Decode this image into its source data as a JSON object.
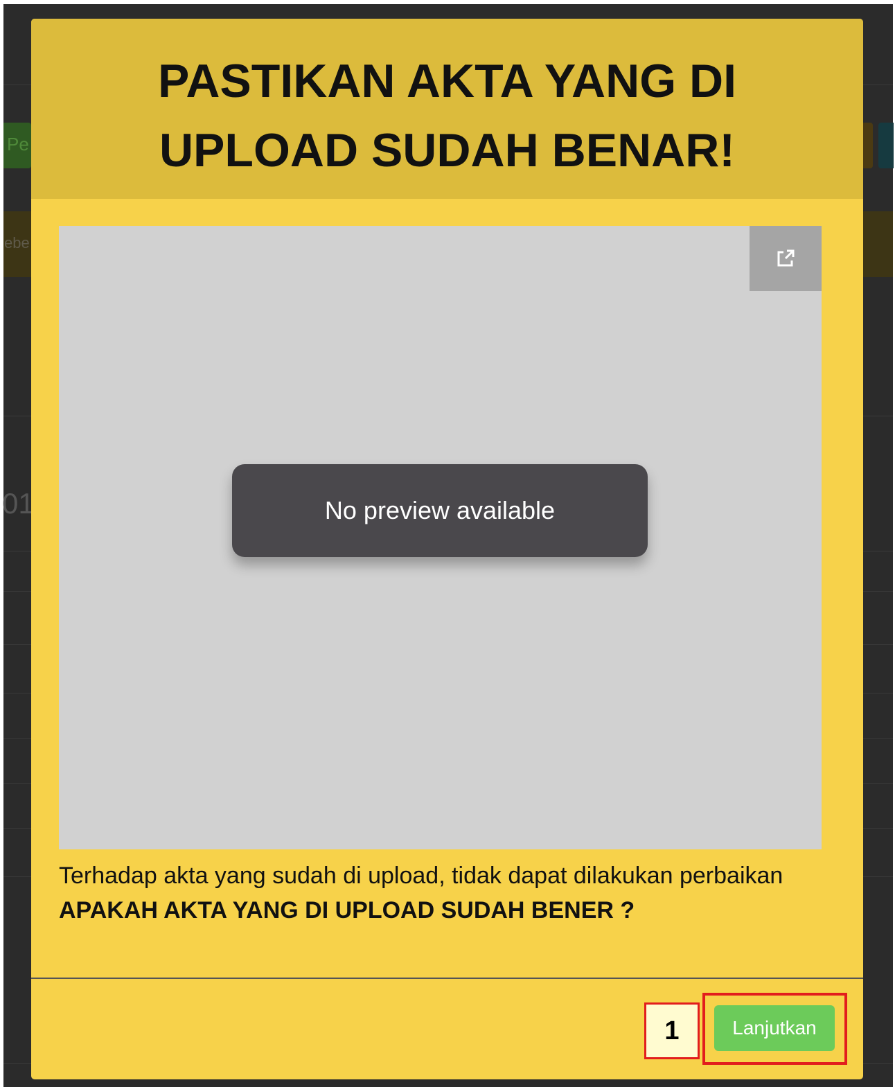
{
  "background": {
    "button_fragment": "Pe",
    "text_fragment": "ebe",
    "number_fragment": "01"
  },
  "modal": {
    "title_line1": "PASTIKAN AKTA YANG DI",
    "title_line2": "UPLOAD SUDAH BENAR!",
    "preview": {
      "message": "No preview available",
      "popout_icon": "external-link-icon"
    },
    "warning_text": "Terhadap akta yang sudah di upload, tidak dapat dilakukan perbaikan",
    "question_text": "APAKAH AKTA YANG DI UPLOAD SUDAH BENER ?",
    "step_number": "1",
    "continue_label": "Lanjutkan"
  },
  "colors": {
    "modal_bg": "#f7d24a",
    "header_bg": "#dcbb3c",
    "continue_button": "#6ccb5a",
    "annotation_red": "#e21d1d"
  }
}
